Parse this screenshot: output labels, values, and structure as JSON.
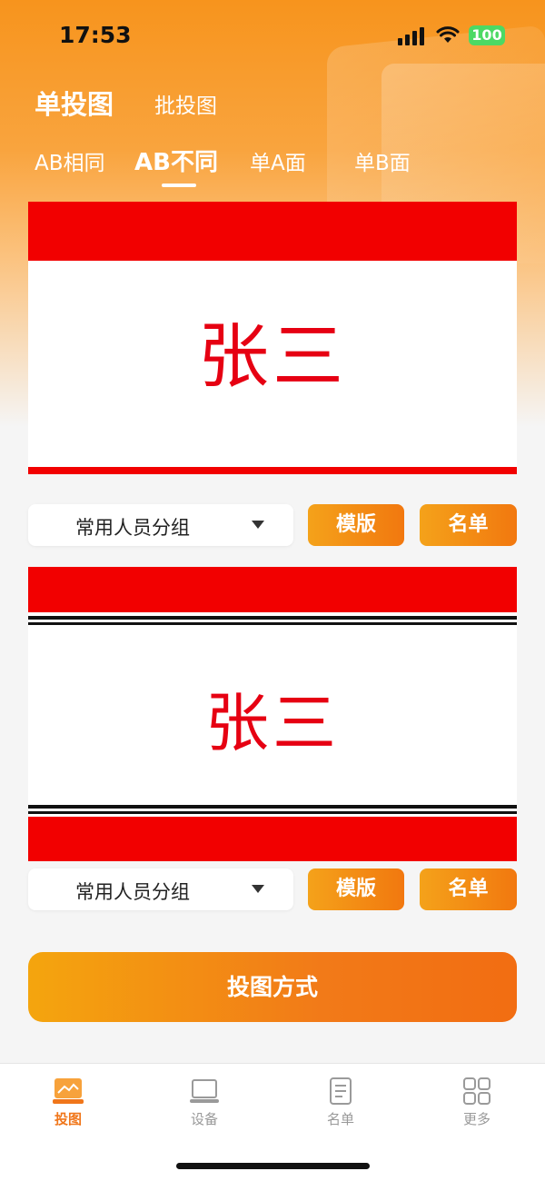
{
  "status_bar": {
    "time": "17:53",
    "battery": "100"
  },
  "header": {
    "tabs": [
      "单投图",
      "批投图"
    ],
    "active_tab": 0
  },
  "sub_tabs": {
    "items": [
      "AB相同",
      "AB不同",
      "单A面",
      "单B面"
    ],
    "active": 1
  },
  "card_a": {
    "name": "张三"
  },
  "card_b": {
    "name": "张三"
  },
  "controls": [
    {
      "group_label": "常用人员分组",
      "template_label": "模版",
      "list_label": "名单"
    },
    {
      "group_label": "常用人员分组",
      "template_label": "模版",
      "list_label": "名单"
    }
  ],
  "main_action": {
    "label": "投图方式"
  },
  "bottom_nav": {
    "items": [
      {
        "label": "投图",
        "icon": "projection-icon",
        "active": true
      },
      {
        "label": "设备",
        "icon": "laptop-icon",
        "active": false
      },
      {
        "label": "名单",
        "icon": "document-icon",
        "active": false
      },
      {
        "label": "更多",
        "icon": "grid-icon",
        "active": false
      }
    ]
  },
  "colors": {
    "accent": "#f2780f",
    "card_red": "#f20000",
    "name_red": "#e60012"
  }
}
